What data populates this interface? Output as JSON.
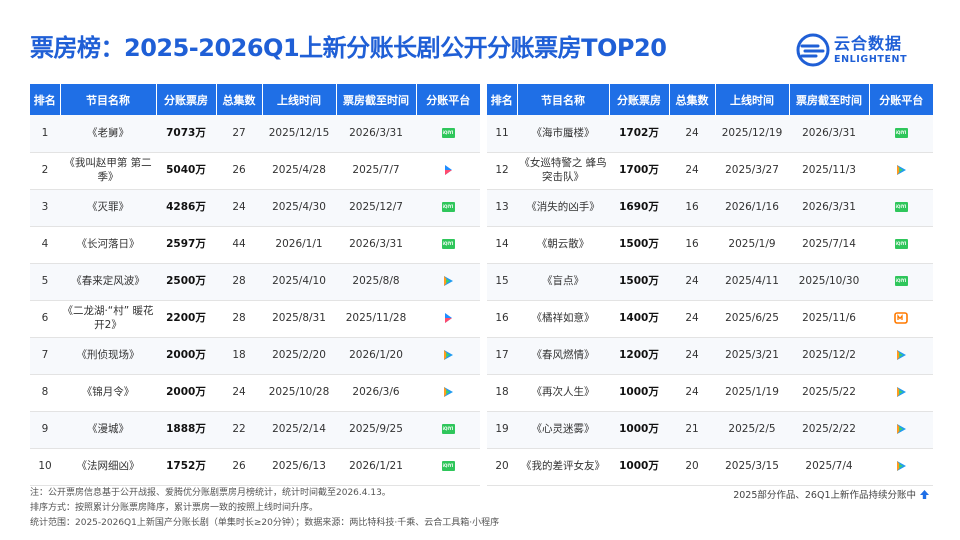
{
  "title": "票房榜：2025-2026Q1上新分账长剧公开分账票房TOP20",
  "logo": {
    "cn": "云合数据",
    "en": "ENLIGHTENT"
  },
  "columns": [
    "排名",
    "节目名称",
    "分账票房",
    "总集数",
    "上线时间",
    "票房截至时间",
    "分账平台"
  ],
  "platform_icons": {
    "iqiyi": "iqiyi-icon",
    "tencent": "tencent-video-icon",
    "youku": "youku-icon",
    "mgtv": "mgtv-icon"
  },
  "rows": [
    {
      "rank": "1",
      "name": "《老舅》",
      "box": "7073万",
      "episodes": "27",
      "launch": "2025/12/15",
      "until": "2026/3/31",
      "platform": "iqiyi"
    },
    {
      "rank": "2",
      "name": "《我叫赵甲第 第二季》",
      "box": "5040万",
      "episodes": "26",
      "launch": "2025/4/28",
      "until": "2025/7/7",
      "platform": "youku"
    },
    {
      "rank": "3",
      "name": "《灭罪》",
      "box": "4286万",
      "episodes": "24",
      "launch": "2025/4/30",
      "until": "2025/12/7",
      "platform": "iqiyi"
    },
    {
      "rank": "4",
      "name": "《长河落日》",
      "box": "2597万",
      "episodes": "44",
      "launch": "2026/1/1",
      "until": "2026/3/31",
      "platform": "iqiyi"
    },
    {
      "rank": "5",
      "name": "《春来定风波》",
      "box": "2500万",
      "episodes": "28",
      "launch": "2025/4/10",
      "until": "2025/8/8",
      "platform": "tencent"
    },
    {
      "rank": "6",
      "name": "《二龙湖·“村” 暖花开2》",
      "box": "2200万",
      "episodes": "28",
      "launch": "2025/8/31",
      "until": "2025/11/28",
      "platform": "youku"
    },
    {
      "rank": "7",
      "name": "《刑侦现场》",
      "box": "2000万",
      "episodes": "18",
      "launch": "2025/2/20",
      "until": "2026/1/20",
      "platform": "tencent"
    },
    {
      "rank": "8",
      "name": "《锦月令》",
      "box": "2000万",
      "episodes": "24",
      "launch": "2025/10/28",
      "until": "2026/3/6",
      "platform": "tencent"
    },
    {
      "rank": "9",
      "name": "《漫城》",
      "box": "1888万",
      "episodes": "22",
      "launch": "2025/2/14",
      "until": "2025/9/25",
      "platform": "iqiyi"
    },
    {
      "rank": "10",
      "name": "《法网细凶》",
      "box": "1752万",
      "episodes": "26",
      "launch": "2025/6/13",
      "until": "2026/1/21",
      "platform": "iqiyi"
    },
    {
      "rank": "11",
      "name": "《海市蜃楼》",
      "box": "1702万",
      "episodes": "24",
      "launch": "2025/12/19",
      "until": "2026/3/31",
      "platform": "iqiyi"
    },
    {
      "rank": "12",
      "name": "《女巡特警之 蜂鸟突击队》",
      "box": "1700万",
      "episodes": "24",
      "launch": "2025/3/27",
      "until": "2025/11/3",
      "platform": "tencent"
    },
    {
      "rank": "13",
      "name": "《消失的凶手》",
      "box": "1690万",
      "episodes": "16",
      "launch": "2026/1/16",
      "until": "2026/3/31",
      "platform": "iqiyi"
    },
    {
      "rank": "14",
      "name": "《朝云散》",
      "box": "1500万",
      "episodes": "16",
      "launch": "2025/1/9",
      "until": "2025/7/14",
      "platform": "iqiyi"
    },
    {
      "rank": "15",
      "name": "《盲点》",
      "box": "1500万",
      "episodes": "24",
      "launch": "2025/4/11",
      "until": "2025/10/30",
      "platform": "iqiyi"
    },
    {
      "rank": "16",
      "name": "《橘祥如意》",
      "box": "1400万",
      "episodes": "24",
      "launch": "2025/6/25",
      "until": "2025/11/6",
      "platform": "mgtv"
    },
    {
      "rank": "17",
      "name": "《春风燃情》",
      "box": "1200万",
      "episodes": "24",
      "launch": "2025/3/21",
      "until": "2025/12/2",
      "platform": "tencent"
    },
    {
      "rank": "18",
      "name": "《再次人生》",
      "box": "1000万",
      "episodes": "24",
      "launch": "2025/1/19",
      "until": "2025/5/22",
      "platform": "tencent"
    },
    {
      "rank": "19",
      "name": "《心灵迷雾》",
      "box": "1000万",
      "episodes": "21",
      "launch": "2025/2/5",
      "until": "2025/2/22",
      "platform": "tencent"
    },
    {
      "rank": "20",
      "name": "《我的差评女友》",
      "box": "1000万",
      "episodes": "20",
      "launch": "2025/3/15",
      "until": "2025/7/4",
      "platform": "tencent"
    }
  ],
  "notes": [
    "注：公开票房信息基于公开战报、爱腾优分账剧票房月榜统计，统计时间截至2026.4.13。",
    "排序方式：按照累计分账票房降序，累计票房一致的按照上线时间升序。",
    "统计范围：2025-2026Q1上新国产分账长剧（单集时长≥20分钟）；数据来源：两比特科技·千乘、云合工具箱·小程序"
  ],
  "tail_text": "2025部分作品、26Q1上新作品持续分账中",
  "colors": {
    "accent": "#1f6fe6",
    "title": "#1f5fd6",
    "iqiyi": "#2fc65b",
    "mgtv": "#ff7a00"
  }
}
